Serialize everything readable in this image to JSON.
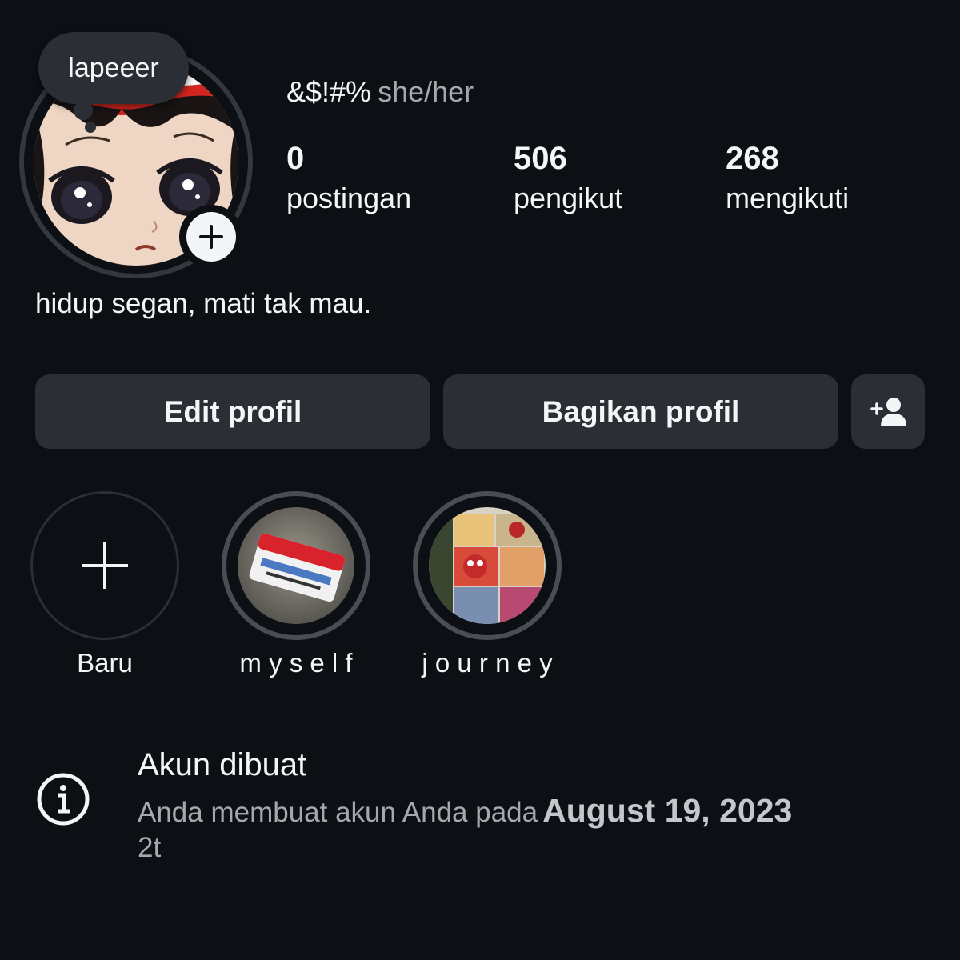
{
  "profile": {
    "note": "lapeeer",
    "name": "&$!#%",
    "pronouns": "she/her",
    "bio": "hidup segan, mati tak mau."
  },
  "stats": [
    {
      "value": "0",
      "label": "postingan"
    },
    {
      "value": "506",
      "label": "pengikut"
    },
    {
      "value": "268",
      "label": "mengikuti"
    }
  ],
  "actions": {
    "edit": "Edit profil",
    "share": "Bagikan profil"
  },
  "highlights": [
    {
      "label": "Baru"
    },
    {
      "label": "m y s e l f"
    },
    {
      "label": "j o u r n e y"
    }
  ],
  "account_info": {
    "title": "Akun dibuat",
    "text": "Anda membuat akun Anda pada",
    "date": "August 19, 2023",
    "time": "2t"
  },
  "icons": {
    "avatar_add": "plus-icon",
    "discover_people": "add-person-icon",
    "new_highlight": "plus-icon",
    "account_info": "info-icon"
  },
  "colors": {
    "background": "#0c0f14",
    "surface": "#2b2e34",
    "text_primary": "#f4f5f7",
    "text_secondary": "#a6a8ad"
  }
}
